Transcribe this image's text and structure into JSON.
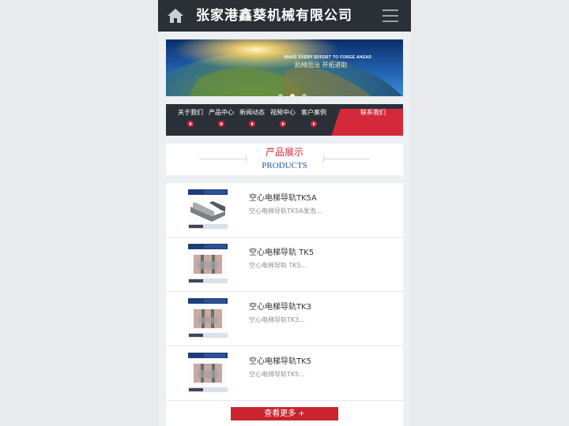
{
  "header": {
    "title": "张家港鑫葵机械有限公司",
    "home_icon": "home-icon",
    "menu_icon": "hamburger-menu-icon"
  },
  "banner": {
    "slogan_en": "MAKE EVERY EFFORT TO FORGE AHEAD",
    "slogan_cn": "励精图治   开拓进取",
    "dots": 3,
    "active_dot": 2
  },
  "nav": {
    "items": [
      {
        "label": "关于我们"
      },
      {
        "label": "产品中心"
      },
      {
        "label": "新闻动态"
      },
      {
        "label": "视频中心"
      },
      {
        "label": "客户案例"
      }
    ],
    "contact_label": "联系我们"
  },
  "section": {
    "title_cn": "产品展示",
    "title_en": "PRODUCTS"
  },
  "products": [
    {
      "name": "空心电梯导轨TK5A",
      "desc": "空心电梯导轨TK5A发泡..."
    },
    {
      "name": "空心电梯导轨 TK5",
      "desc": "空心电梯导轨 TK5..."
    },
    {
      "name": "空心电梯导轨TK3",
      "desc": "空心电梯导轨TK3..."
    },
    {
      "name": "空心电梯导轨TK5",
      "desc": "空心电梯导轨TK5..."
    }
  ],
  "more_label": "查看更多 +",
  "colors": {
    "header_bg": "#2b3036",
    "accent_red": "#d5283b",
    "link_blue": "#1e5aa8"
  }
}
